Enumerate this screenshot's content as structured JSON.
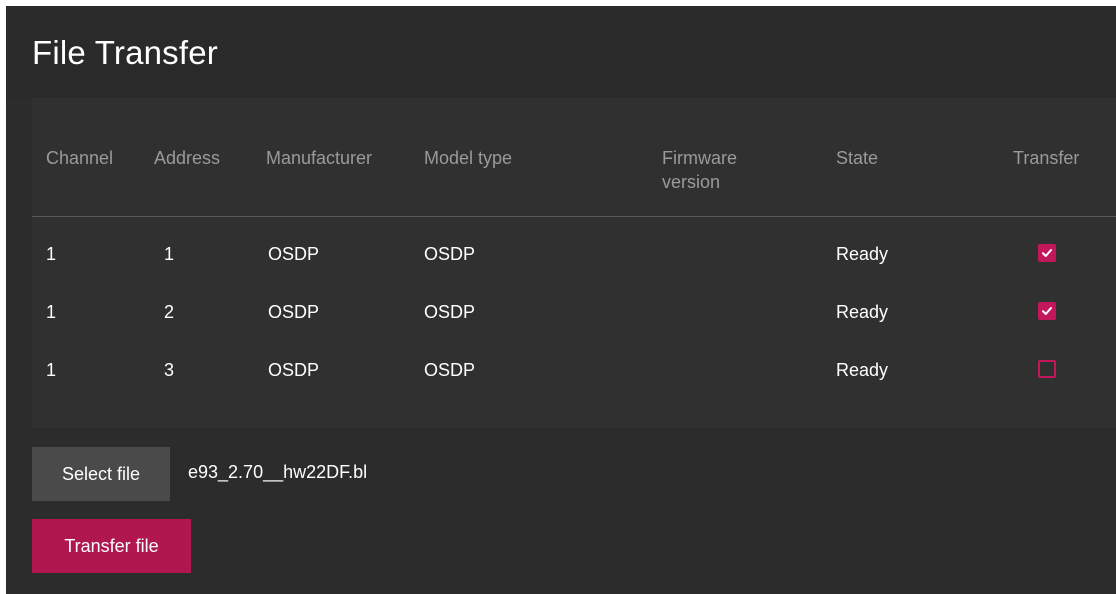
{
  "page": {
    "title": "File Transfer"
  },
  "table": {
    "headers": {
      "channel": "Channel",
      "address": "Address",
      "manufacturer": "Manufacturer",
      "model_type": "Model type",
      "firmware_line1": "Firmware",
      "firmware_line2": "version",
      "state": "State",
      "transfer": "Transfer"
    },
    "rows": [
      {
        "channel": "1",
        "address": "1",
        "manufacturer": "OSDP",
        "model_type": "OSDP",
        "firmware": "",
        "state": "Ready",
        "transfer": true
      },
      {
        "channel": "1",
        "address": "2",
        "manufacturer": "OSDP",
        "model_type": "OSDP",
        "firmware": "",
        "state": "Ready",
        "transfer": true
      },
      {
        "channel": "1",
        "address": "3",
        "manufacturer": "OSDP",
        "model_type": "OSDP",
        "firmware": "",
        "state": "Ready",
        "transfer": false
      }
    ]
  },
  "file": {
    "select_label": "Select file",
    "selected_name": "e93_2.70__hw22DF.bl",
    "transfer_label": "Transfer file"
  },
  "colors": {
    "accent": "#c2185b",
    "background": "#2c2c2c",
    "header_text": "#9a9a9a"
  },
  "icons": {
    "checkbox_checked": "checkmark-icon"
  }
}
